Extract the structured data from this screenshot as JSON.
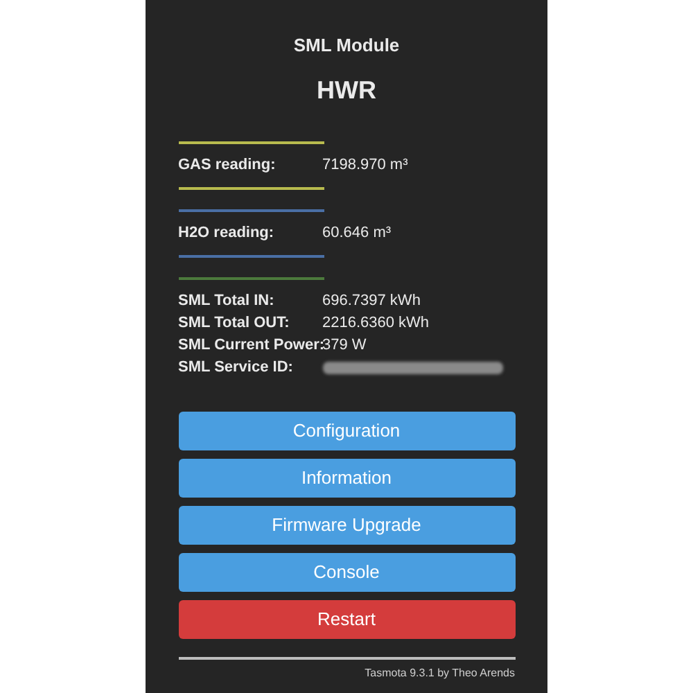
{
  "header": {
    "module": "SML Module",
    "device": "HWR"
  },
  "groups": [
    {
      "color": "#b8bb4e",
      "closed": true,
      "rows": [
        {
          "label": "GAS reading:",
          "value": "7198.970 m³"
        }
      ]
    },
    {
      "color": "#4a6fa5",
      "closed": true,
      "rows": [
        {
          "label": "H2O reading:",
          "value": "60.646 m³"
        }
      ]
    },
    {
      "color": "#4c7a3c",
      "closed": false,
      "rows": [
        {
          "label": "SML Total IN:",
          "value": "696.7397 kWh"
        },
        {
          "label": "SML Total OUT:",
          "value": "2216.6360 kWh"
        },
        {
          "label": "SML Current Power:",
          "value": "379 W"
        },
        {
          "label": "SML Service ID:",
          "redacted": true
        }
      ]
    }
  ],
  "buttons": [
    {
      "label": "Configuration",
      "kind": "normal"
    },
    {
      "label": "Information",
      "kind": "normal"
    },
    {
      "label": "Firmware Upgrade",
      "kind": "normal"
    },
    {
      "label": "Console",
      "kind": "normal"
    },
    {
      "label": "Restart",
      "kind": "danger"
    }
  ],
  "footer": "Tasmota 9.3.1 by Theo Arends"
}
